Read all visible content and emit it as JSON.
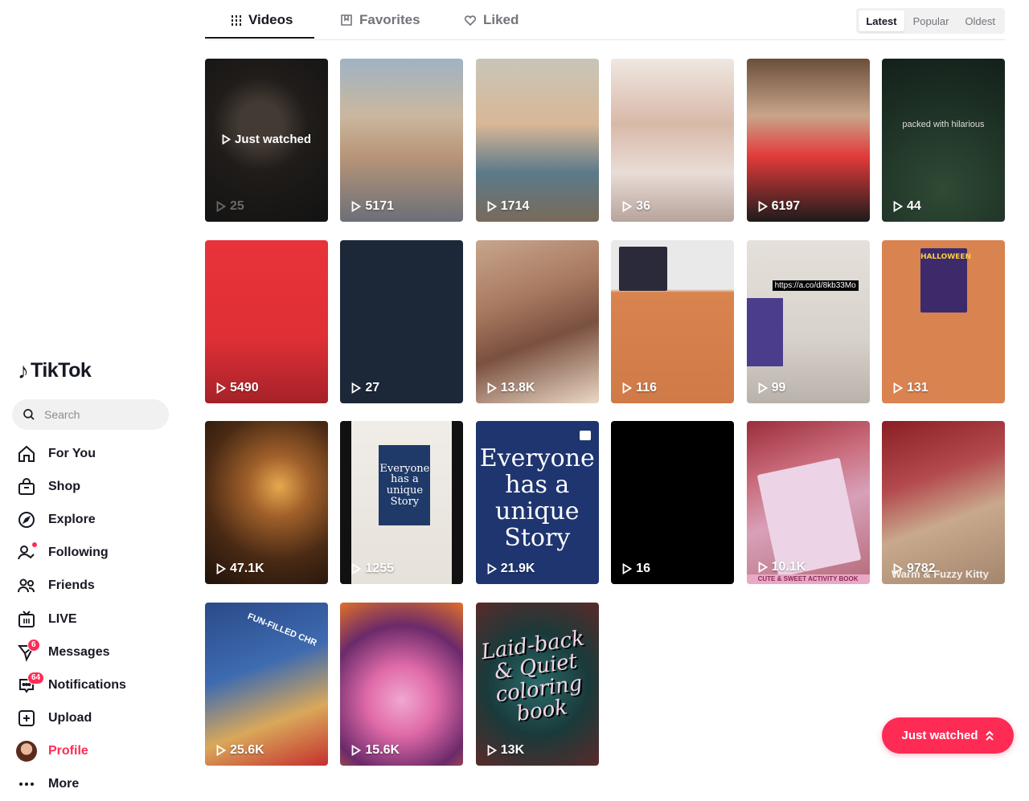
{
  "sidebar": {
    "logo_text": "TikTok",
    "search_placeholder": "Search",
    "items": [
      {
        "label": "For You"
      },
      {
        "label": "Shop"
      },
      {
        "label": "Explore"
      },
      {
        "label": "Following"
      },
      {
        "label": "Friends"
      },
      {
        "label": "LIVE"
      },
      {
        "label": "Messages",
        "badge": "6"
      },
      {
        "label": "Notifications",
        "badge": "64"
      },
      {
        "label": "Upload"
      },
      {
        "label": "Profile"
      },
      {
        "label": "More"
      }
    ]
  },
  "tabs": [
    {
      "label": "Videos",
      "icon": "grid-icon"
    },
    {
      "label": "Favorites",
      "icon": "bookmark-icon"
    },
    {
      "label": "Liked",
      "icon": "heart-outline-icon"
    }
  ],
  "sort": {
    "options": [
      "Latest",
      "Popular",
      "Oldest"
    ],
    "selected": "Latest"
  },
  "videos": [
    {
      "views": "25",
      "overlay": "Just watched"
    },
    {
      "views": "5171"
    },
    {
      "views": "1714"
    },
    {
      "views": "36"
    },
    {
      "views": "6197"
    },
    {
      "views": "44",
      "caption": "packed with hilarious"
    },
    {
      "views": "5490"
    },
    {
      "views": "27"
    },
    {
      "views": "13.8K"
    },
    {
      "views": "116"
    },
    {
      "views": "99",
      "caption": "https://a.co/d/8kb33Mo"
    },
    {
      "views": "131",
      "caption": "HALLOWEEN"
    },
    {
      "views": "47.1K"
    },
    {
      "views": "1255",
      "caption": "Everyone has a unique Story"
    },
    {
      "views": "21.9K",
      "caption": "Everyone has a unique Story"
    },
    {
      "views": "16"
    },
    {
      "views": "10.1K",
      "caption": "CUTE & SWEET ACTIVITY BOOK"
    },
    {
      "views": "9782",
      "caption": "Warm & Fuzzy Kitty"
    },
    {
      "views": "25.6K",
      "caption": "FUN-FILLED CHR"
    },
    {
      "views": "15.6K"
    },
    {
      "views": "13K",
      "caption": "Laid-back & Quiet coloring book"
    }
  ],
  "just_watched_button": "Just watched",
  "colors": {
    "accent": "#fe2c55",
    "text": "#161823"
  }
}
